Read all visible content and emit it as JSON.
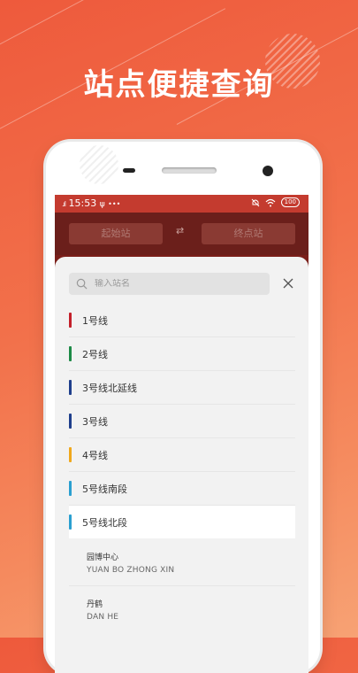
{
  "headline": "站点便捷查询",
  "statusbar": {
    "time": "15:53",
    "extra": "•••",
    "battery": "100"
  },
  "header": {
    "start_station_label": "起始站",
    "end_station_label": "终点站",
    "swap_symbol": "⇄"
  },
  "search": {
    "placeholder": "输入站名"
  },
  "lines": [
    {
      "label": "1号线",
      "color": "#c3202a"
    },
    {
      "label": "2号线",
      "color": "#1d8a47"
    },
    {
      "label": "3号线北延线",
      "color": "#1f3f8c"
    },
    {
      "label": "3号线",
      "color": "#1f3f8c"
    },
    {
      "label": "4号线",
      "color": "#f0a81c"
    },
    {
      "label": "5号线南段",
      "color": "#2a9fd0"
    },
    {
      "label": "5号线北段",
      "color": "#2a9fd0",
      "selected": true
    }
  ],
  "stations": [
    {
      "name": "园博中心",
      "pinyin": "YUAN BO ZHONG XIN"
    },
    {
      "name": "丹鹤",
      "pinyin": "DAN HE"
    }
  ]
}
